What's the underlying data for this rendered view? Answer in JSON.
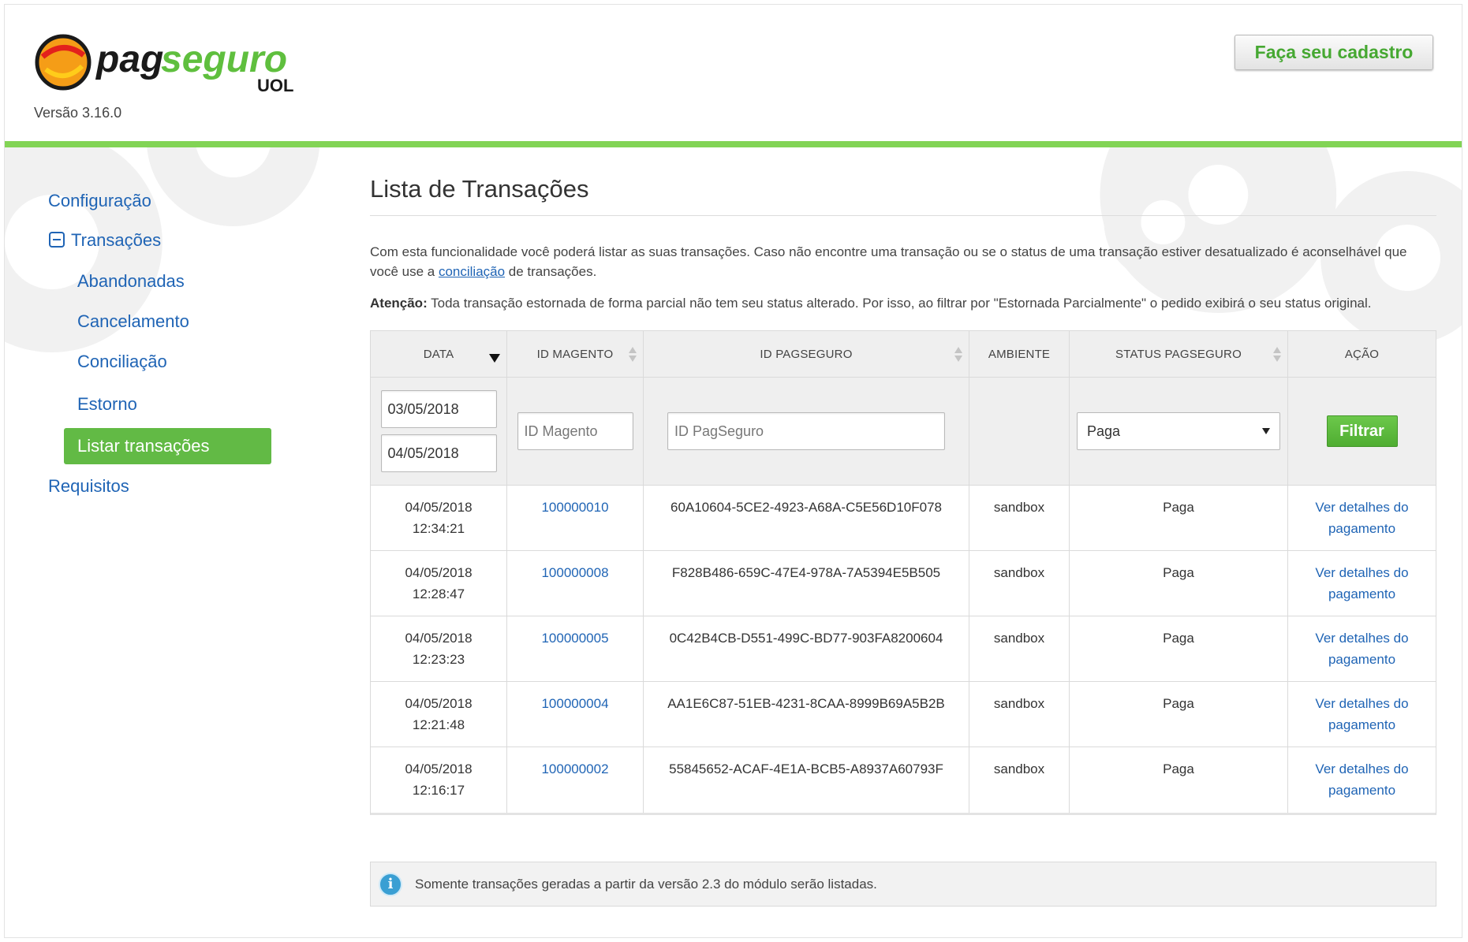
{
  "header": {
    "logo_text": "pagseguro",
    "logo_sub": "UOL",
    "version": "Versão 3.16.0",
    "signup_label": "Faça seu cadastro"
  },
  "colors": {
    "brand_green": "#82d455",
    "link_blue": "#1f64b5",
    "active_green": "#62ba45",
    "info_blue": "#3a9fd3"
  },
  "sidebar": {
    "items": [
      {
        "label": "Configuração"
      },
      {
        "label": "Transações",
        "icon": "collapse-minus-icon"
      },
      {
        "label": "Abandonadas"
      },
      {
        "label": "Cancelamento"
      },
      {
        "label": "Conciliação"
      },
      {
        "label": "Estorno"
      },
      {
        "label": "Listar transações",
        "active": true
      },
      {
        "label": "Requisitos"
      }
    ]
  },
  "main": {
    "title": "Lista de Transações",
    "intro_before": "Com esta funcionalidade você poderá listar as suas transações. Caso não encontre uma transação ou se o status de uma transação estiver desatualizado é aconselhável que você use a ",
    "intro_link": "conciliação",
    "intro_after": " de transações.",
    "attention_label": "Atenção:",
    "attention_text": " Toda transação estornada de forma parcial não tem seu status alterado. Por isso, ao filtrar por \"Estornada Parcialmente\" o pedido exibirá o seu status original."
  },
  "table": {
    "headers": [
      "DATA",
      "ID MAGENTO",
      "ID PAGSEGURO",
      "AMBIENTE",
      "STATUS PAGSEGURO",
      "AÇÃO"
    ],
    "filters": {
      "date_from": "03/05/2018",
      "date_to": "04/05/2018",
      "magento_placeholder": "ID Magento",
      "pagseguro_placeholder": "ID PagSeguro",
      "status_selected": "Paga",
      "filter_label": "Filtrar"
    },
    "rows": [
      {
        "date": "04/05/2018",
        "time": "12:34:21",
        "magento_id": "100000010",
        "pagseguro_id": "60A10604-5CE2-4923-A68A-C5E56D10F078",
        "environment": "sandbox",
        "status": "Paga",
        "action_1": "Ver detalhes do",
        "action_2": "pagamento"
      },
      {
        "date": "04/05/2018",
        "time": "12:28:47",
        "magento_id": "100000008",
        "pagseguro_id": "F828B486-659C-47E4-978A-7A5394E5B505",
        "environment": "sandbox",
        "status": "Paga",
        "action_1": "Ver detalhes do",
        "action_2": "pagamento"
      },
      {
        "date": "04/05/2018",
        "time": "12:23:23",
        "magento_id": "100000005",
        "pagseguro_id": "0C42B4CB-D551-499C-BD77-903FA8200604",
        "environment": "sandbox",
        "status": "Paga",
        "action_1": "Ver detalhes do",
        "action_2": "pagamento"
      },
      {
        "date": "04/05/2018",
        "time": "12:21:48",
        "magento_id": "100000004",
        "pagseguro_id": "AA1E6C87-51EB-4231-8CAA-8999B69A5B2B",
        "environment": "sandbox",
        "status": "Paga",
        "action_1": "Ver detalhes do",
        "action_2": "pagamento"
      },
      {
        "date": "04/05/2018",
        "time": "12:16:17",
        "magento_id": "100000002",
        "pagseguro_id": "55845652-ACAF-4E1A-BCB5-A8937A60793F",
        "environment": "sandbox",
        "status": "Paga",
        "action_1": "Ver detalhes do",
        "action_2": "pagamento"
      }
    ]
  },
  "notice": {
    "icon": "info-icon",
    "text": "Somente transações geradas a partir da versão 2.3 do módulo serão listadas."
  }
}
